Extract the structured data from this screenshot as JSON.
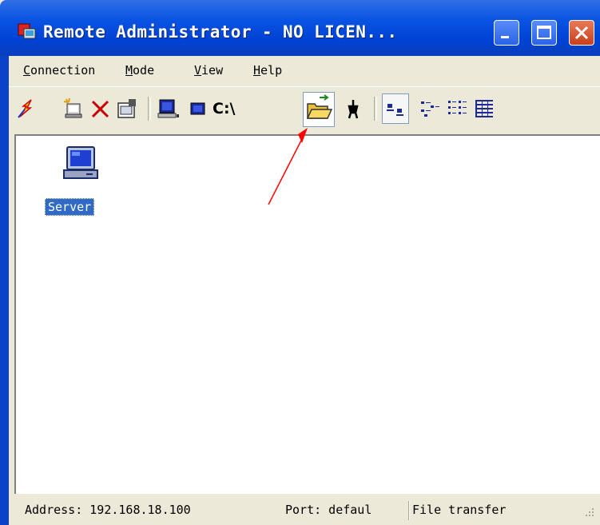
{
  "window": {
    "title": "Remote Administrator - NO LICEN...",
    "colors": {
      "titlebar": "#0a54e3",
      "selection": "#316ac5",
      "annotation_arrow": "#ff0000"
    }
  },
  "menu": {
    "items": [
      {
        "label": "Connection",
        "accel": "C",
        "rest": "onnection"
      },
      {
        "label": "Mode",
        "accel": "M",
        "rest": "ode"
      },
      {
        "label": "View",
        "accel": "V",
        "rest": "iew"
      },
      {
        "label": "Help",
        "accel": "H",
        "rest": "elp"
      }
    ]
  },
  "toolbar": {
    "icons": [
      "connect-icon",
      "new-connection-icon",
      "delete-icon",
      "properties-icon",
      "full-control-icon",
      "view-only-icon",
      "telnet-icon",
      "file-transfer-icon",
      "shutdown-icon",
      "large-icons-view-icon",
      "small-icons-view-icon",
      "list-view-icon",
      "details-view-icon"
    ],
    "telnet_label": "C:\\",
    "selected": "file-transfer-icon"
  },
  "connections": [
    {
      "label": "Server",
      "icon": "computer-icon"
    }
  ],
  "status": {
    "address": "Address: 192.168.18.100",
    "port": "Port: defaul",
    "mode": "File transfer"
  }
}
